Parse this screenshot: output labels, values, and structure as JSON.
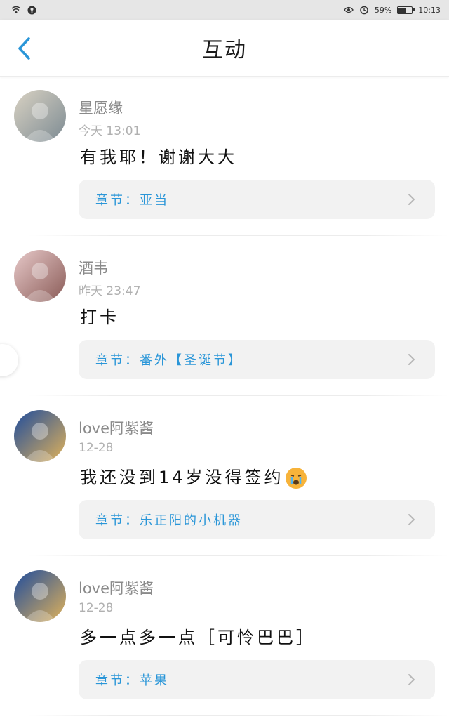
{
  "status_bar": {
    "time": "10:13",
    "battery_percent": "59%",
    "battery_level": 0.59
  },
  "header": {
    "title": "互动",
    "back_icon": "chevron-left-icon",
    "accent": "#2a96d8"
  },
  "comments": [
    {
      "name": "星愿缘",
      "time": "今天  13:01",
      "text": "有我耶！谢谢大大",
      "chapter": "章节：亚当",
      "avatar_colors": [
        "#d9d2c3",
        "#7d8b93"
      ]
    },
    {
      "name": "酒韦",
      "time": "昨天  23:47",
      "text": "打卡",
      "chapter": "章节：番外【圣诞节】",
      "avatar_colors": [
        "#e7c9c9",
        "#8a5b57"
      ]
    },
    {
      "name": "love阿紫酱",
      "time": "12-28",
      "text": "我还没到14岁没得签约",
      "emoji": "crying-face-emoji",
      "chapter": "章节：乐正阳的小机器",
      "avatar_colors": [
        "#1f4c9c",
        "#e0b25a"
      ]
    },
    {
      "name": "love阿紫酱",
      "time": "12-28",
      "text": "多一点多一点［可怜巴巴］",
      "chapter": "章节：苹果",
      "avatar_colors": [
        "#1f4c9c",
        "#e0b25a"
      ]
    }
  ]
}
